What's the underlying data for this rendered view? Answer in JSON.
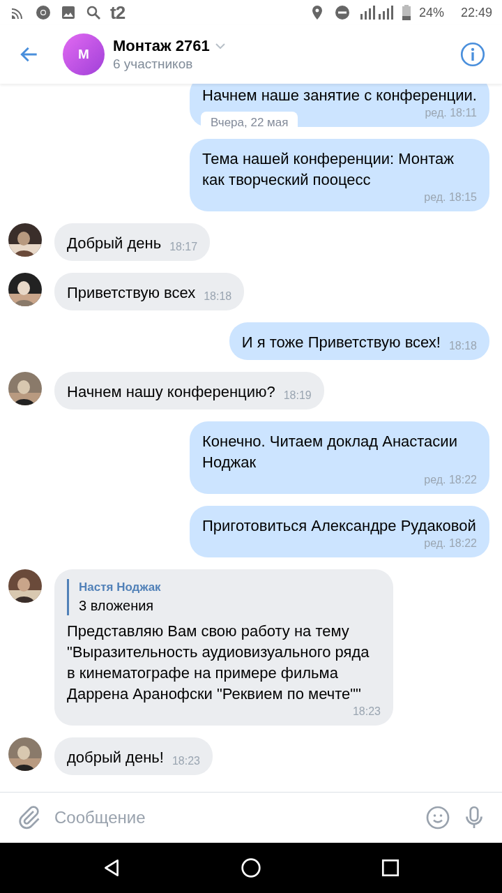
{
  "status_bar": {
    "battery": "24%",
    "time": "22:49",
    "operator": "t2"
  },
  "header": {
    "avatar_letter": "М",
    "title": "Монтаж 2761",
    "subtitle": "6 участников"
  },
  "date_chip": "Вчера, 22 мая",
  "messages": [
    {
      "kind": "out",
      "text": "Начнем наше занятие с конференции.",
      "time": "ред. 18:11"
    },
    {
      "kind": "out",
      "text": "Тема нашей конференции: Монтаж как творческий пооцесс",
      "time": "ред. 18:15"
    },
    {
      "kind": "in",
      "text": "Добрый день",
      "time": "18:17"
    },
    {
      "kind": "in",
      "text": "Приветствую всех",
      "time": "18:18"
    },
    {
      "kind": "out",
      "text": "И я тоже Приветствую всех!",
      "time": "18:18"
    },
    {
      "kind": "in",
      "text": "Начнем нашу конференцию?",
      "time": "18:19"
    },
    {
      "kind": "out",
      "text": "Конечно. Читаем доклад Анастасии Ноджак",
      "time": "ред. 18:22"
    },
    {
      "kind": "out",
      "text": "Приготовиться Александре Рудаковой",
      "time": "ред. 18:22"
    },
    {
      "kind": "in",
      "reply": {
        "author": "Настя Ноджак",
        "attachments": "3 вложения"
      },
      "text": "Представляю Вам свою работу на тему \"Выразительность аудиовизуального ряда в кинематографе на примере фильма Даррена Аранофски \"Реквием по мечте\"\"",
      "time": "18:23"
    },
    {
      "kind": "in",
      "text": "добрый день!",
      "time": "18:23"
    }
  ],
  "composer": {
    "placeholder": "Сообщение"
  }
}
